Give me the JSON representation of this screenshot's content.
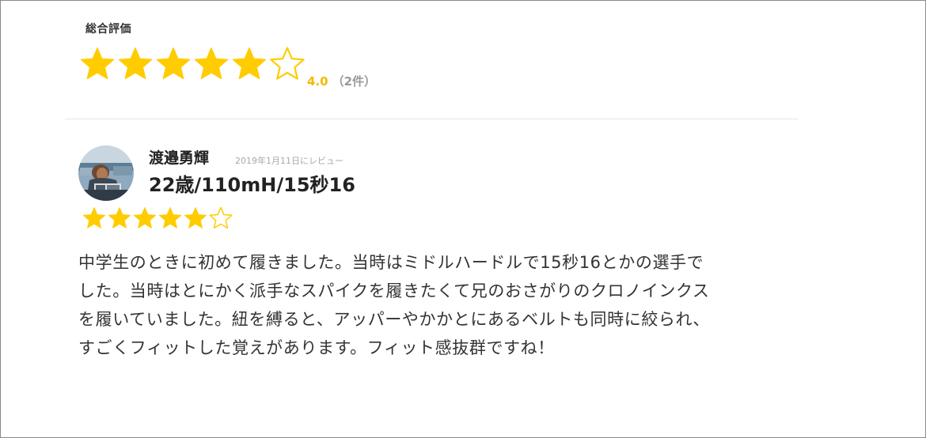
{
  "overall": {
    "label": "総合評価",
    "rating": 4.0,
    "max_rating": 6,
    "score_text": "4.0",
    "count_text": "（2件）"
  },
  "review": {
    "name": "渡邉勇輝",
    "date": "2019年1月11日にレビュー",
    "profile": "22歳/110mH/15秒16",
    "rating": 5,
    "max_rating": 6,
    "body_lines": [
      "中学生のときに初めて履きました。当時はミドルハードルで15秒16とかの選手で",
      "した。当時はとにかく派手なスパイクを履きたくて兄のおさがりのクロノインクス",
      "を履いていました。紐を縛ると、アッパーやかかとにあるベルトも同時に絞られ、",
      "すごくフィットした覚えがあります。フィット感抜群ですね！"
    ]
  },
  "colors": {
    "star": "#ffcc00",
    "score": "#f5b800",
    "text": "#333333",
    "muted": "#a8a8a8"
  },
  "icons": {
    "filled_star": "star-filled-icon",
    "empty_star": "star-outline-icon",
    "avatar": "avatar"
  }
}
